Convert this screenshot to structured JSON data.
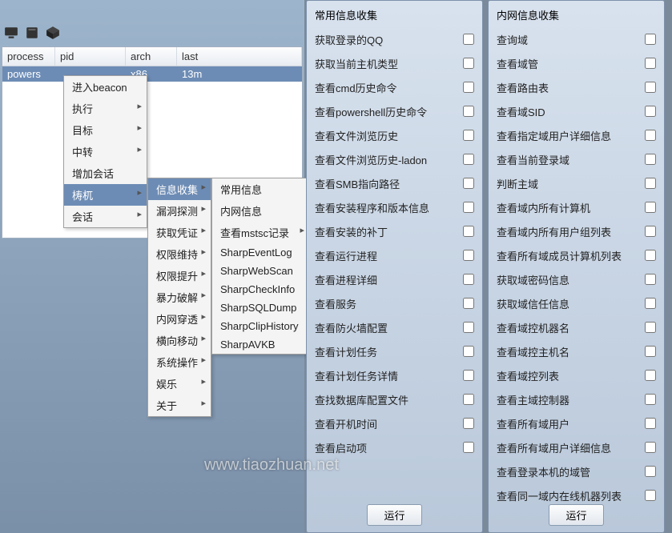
{
  "toolbar_icons": [
    "monitor-icon",
    "book-icon",
    "cube-icon"
  ],
  "table": {
    "headers": {
      "process": "process",
      "pid": "pid",
      "arch": "arch",
      "last": "last"
    },
    "row": {
      "process": "powers",
      "pid": "",
      "arch": "x86",
      "last": "13m"
    }
  },
  "menu1": [
    {
      "label": "进入beacon",
      "sub": false,
      "hl": false
    },
    {
      "label": "执行",
      "sub": true,
      "hl": false
    },
    {
      "label": "目标",
      "sub": true,
      "hl": false
    },
    {
      "label": "中转",
      "sub": true,
      "hl": false
    },
    {
      "label": "增加会话",
      "sub": false,
      "hl": false
    },
    {
      "label": "梼杌",
      "sub": true,
      "hl": true
    },
    {
      "label": "会话",
      "sub": true,
      "hl": false
    }
  ],
  "menu2": [
    {
      "label": "信息收集",
      "sub": true,
      "hl": true
    },
    {
      "label": "漏洞探测",
      "sub": true,
      "hl": false
    },
    {
      "label": "获取凭证",
      "sub": true,
      "hl": false
    },
    {
      "label": "权限维持",
      "sub": true,
      "hl": false
    },
    {
      "label": "权限提升",
      "sub": true,
      "hl": false
    },
    {
      "label": "暴力破解",
      "sub": true,
      "hl": false
    },
    {
      "label": "内网穿透",
      "sub": true,
      "hl": false
    },
    {
      "label": "横向移动",
      "sub": true,
      "hl": false
    },
    {
      "label": "系统操作",
      "sub": true,
      "hl": false
    },
    {
      "label": "娱乐",
      "sub": true,
      "hl": false
    },
    {
      "label": "关于",
      "sub": true,
      "hl": false
    }
  ],
  "menu3": [
    {
      "label": "常用信息",
      "sub": false
    },
    {
      "label": "内网信息",
      "sub": false
    },
    {
      "label": "查看mstsc记录",
      "sub": true
    },
    {
      "label": "SharpEventLog",
      "sub": false
    },
    {
      "label": "SharpWebScan",
      "sub": false
    },
    {
      "label": "SharpCheckInfo",
      "sub": false
    },
    {
      "label": "SharpSQLDump",
      "sub": false
    },
    {
      "label": "SharpClipHistory",
      "sub": false
    },
    {
      "label": "SharpAVKB",
      "sub": false
    }
  ],
  "panel_common": {
    "title": "常用信息收集",
    "items": [
      "获取登录的QQ",
      "获取当前主机类型",
      "查看cmd历史命令",
      "查看powershell历史命令",
      "查看文件浏览历史",
      "查看文件浏览历史-ladon",
      "查看SMB指向路径",
      "查看安装程序和版本信息",
      "查看安装的补丁",
      "查看运行进程",
      "查看进程详细",
      "查看服务",
      "查看防火墙配置",
      "查看计划任务",
      "查看计划任务详情",
      "查找数据库配置文件",
      "查看开机时间",
      "查看启动项"
    ],
    "run": "运行"
  },
  "panel_internal": {
    "title": "内网信息收集",
    "items": [
      "查询域",
      "查看域管",
      "查看路由表",
      "查看域SID",
      "查看指定域用户详细信息",
      "查看当前登录域",
      "判断主域",
      "查看域内所有计算机",
      "查看域内所有用户组列表",
      "查看所有域成员计算机列表",
      "获取域密码信息",
      "获取域信任信息",
      "查看域控机器名",
      "查看域控主机名",
      "查看域控列表",
      "查看主域控制器",
      "查看所有域用户",
      "查看所有域用户详细信息",
      "查看登录本机的域管",
      "查看同一域内在线机器列表"
    ],
    "run": "运行"
  },
  "watermark": "www.tiaozhuan.net"
}
